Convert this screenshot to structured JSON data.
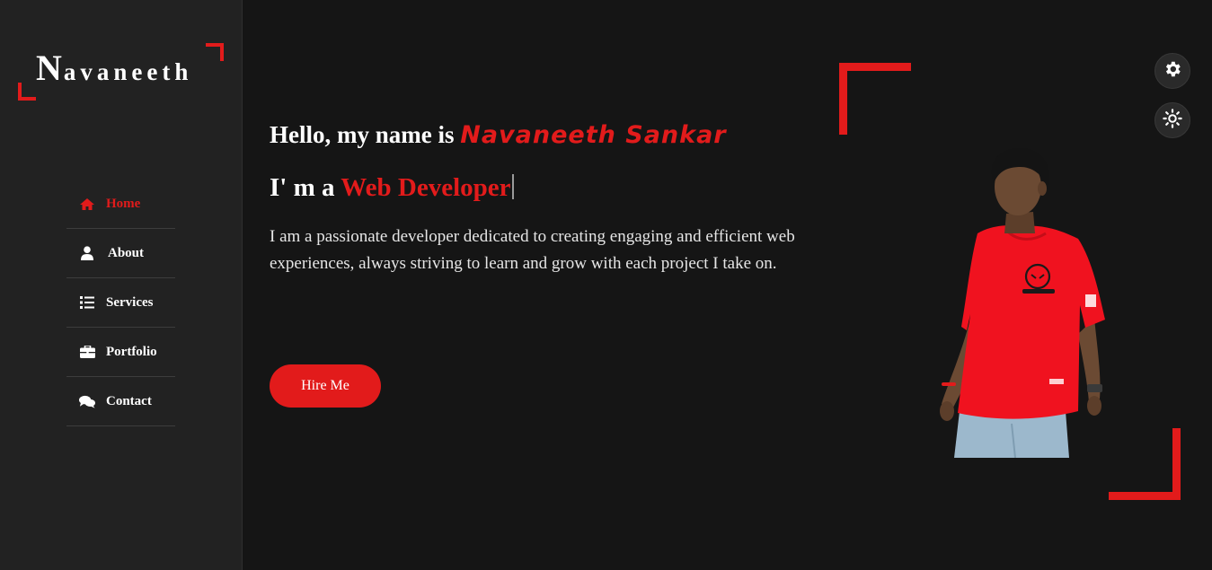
{
  "logo": {
    "initial": "N",
    "rest": "avaneeth"
  },
  "nav": {
    "items": [
      {
        "label": "Home",
        "icon": "home-icon",
        "active": true
      },
      {
        "label": "About",
        "icon": "user-icon",
        "active": false
      },
      {
        "label": "Services",
        "icon": "list-icon",
        "active": false
      },
      {
        "label": "Portfolio",
        "icon": "briefcase-icon",
        "active": false
      },
      {
        "label": "Contact",
        "icon": "comments-icon",
        "active": false
      }
    ]
  },
  "hero": {
    "greeting": "Hello, my name is ",
    "name": "Navaneeth Sankar",
    "role_prefix": "I' m a ",
    "role": "Web Developer",
    "bio": "I am a passionate developer dedicated to creating engaging and efficient web experiences, always striving to learn and grow with each project I take on.",
    "cta_label": "Hire Me"
  },
  "controls": {
    "settings_icon": "gear-icon",
    "theme_icon": "sun-icon"
  },
  "colors": {
    "accent": "#e21b1b",
    "background": "#151515",
    "sidebar": "#222222",
    "text": "#ffffff"
  }
}
